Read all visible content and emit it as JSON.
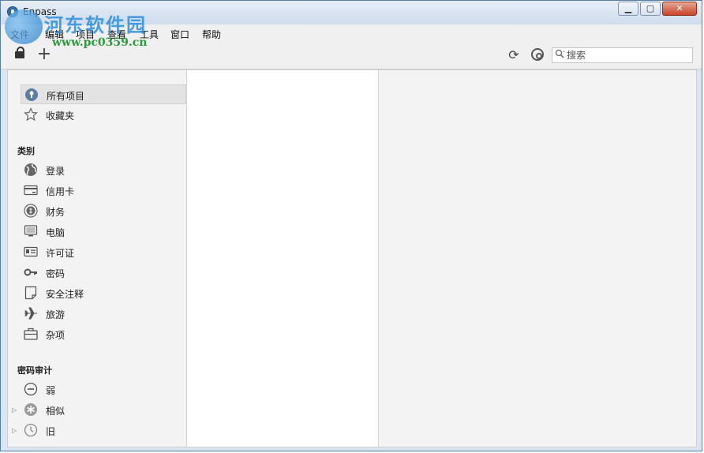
{
  "window": {
    "title": "Enpass"
  },
  "watermark": {
    "text": "河东软件园",
    "url": "www.pc0359.cn"
  },
  "menu": [
    "文件",
    "编辑",
    "项目",
    "查看",
    "工具",
    "窗口",
    "帮助"
  ],
  "search": {
    "placeholder": "搜索"
  },
  "sidebar": {
    "top_items": [
      {
        "label": "所有项目",
        "icon": "all-items-icon",
        "selected": true
      },
      {
        "label": "收藏夹",
        "icon": "star-icon",
        "selected": false
      }
    ],
    "categories_header": "类别",
    "categories": [
      {
        "label": "登录",
        "icon": "globe-icon"
      },
      {
        "label": "信用卡",
        "icon": "credit-card-icon"
      },
      {
        "label": "财务",
        "icon": "finance-icon"
      },
      {
        "label": "电脑",
        "icon": "computer-icon"
      },
      {
        "label": "许可证",
        "icon": "license-icon"
      },
      {
        "label": "密码",
        "icon": "key-icon"
      },
      {
        "label": "安全注释",
        "icon": "note-icon"
      },
      {
        "label": "旅游",
        "icon": "airplane-icon"
      },
      {
        "label": "杂项",
        "icon": "briefcase-icon"
      }
    ],
    "audit_header": "密码审计",
    "audit": [
      {
        "label": "弱",
        "icon": "minus-circle-icon",
        "expandable": false
      },
      {
        "label": "相似",
        "icon": "similar-icon",
        "expandable": true
      },
      {
        "label": "旧",
        "icon": "clock-icon",
        "expandable": true
      }
    ]
  }
}
